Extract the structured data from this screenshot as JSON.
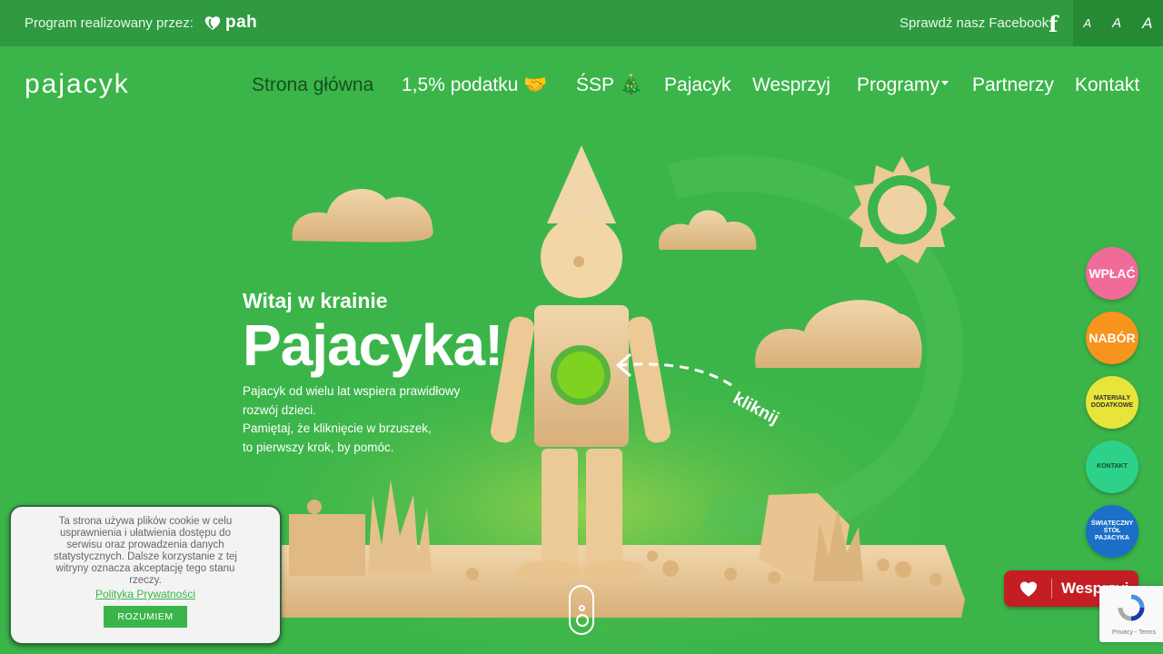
{
  "topbar": {
    "program_label": "Program realizowany przez:",
    "pah_logo_text": "pah",
    "facebook_text": "Sprawdź nasz Facebook",
    "facebook_icon": "facebook-icon",
    "font_size_options": [
      "A",
      "A",
      "A"
    ]
  },
  "header": {
    "logo": "pajacyk",
    "nav": [
      {
        "label": "Strona główna"
      },
      {
        "label": "1,5% podatku 🤝"
      },
      {
        "label": "ŚSP 🎄"
      },
      {
        "label": "Pajacyk"
      },
      {
        "label": "Wesprzyj"
      },
      {
        "label": "Programy"
      },
      {
        "label": "Partnerzy"
      },
      {
        "label": "Kontakt"
      }
    ]
  },
  "hero": {
    "subtitle": "Witaj w krainie",
    "title": "Pajacyka!",
    "body_line1": "Pajacyk od wielu lat wspiera prawidłowy",
    "body_line2": "rozwój dzieci.",
    "body_line3": "Pamiętaj, że kliknięcie w brzuszek,",
    "body_line4": "to pierwszy krok, by pomóc.",
    "click_hint": "kliknij"
  },
  "floating_buttons": [
    {
      "label": "WPŁAĆ",
      "color": "#f06a9a"
    },
    {
      "label": "NABÓR",
      "color": "#f7941d"
    },
    {
      "label": "MATERIAŁY DODATKOWE",
      "color": "#e8e43a"
    },
    {
      "label": "KONTAKT",
      "color": "#2dd18a"
    },
    {
      "label": "ŚWIĄTECZNY STÓŁ PAJACYKA",
      "color": "#1b6fc6"
    }
  ],
  "donate_button": {
    "label": "Wesprzyj",
    "color": "#c41e24"
  },
  "recaptcha": {
    "text": "Privacy - Terms"
  },
  "cookie": {
    "text": "Ta strona używa plików cookie w celu usprawnienia i ułatwienia dostępu do serwisu oraz prowadzenia danych statystycznych. Dalsze korzystanie z tej witryny oznacza akceptację tego stanu rzeczy.",
    "policy_link": "Polityka Prywatności",
    "accept_button": "ROZUMIEM"
  },
  "colors": {
    "background": "#3bb54a",
    "topbar": "#2f9a3f",
    "accent_dark": "#15501e"
  }
}
